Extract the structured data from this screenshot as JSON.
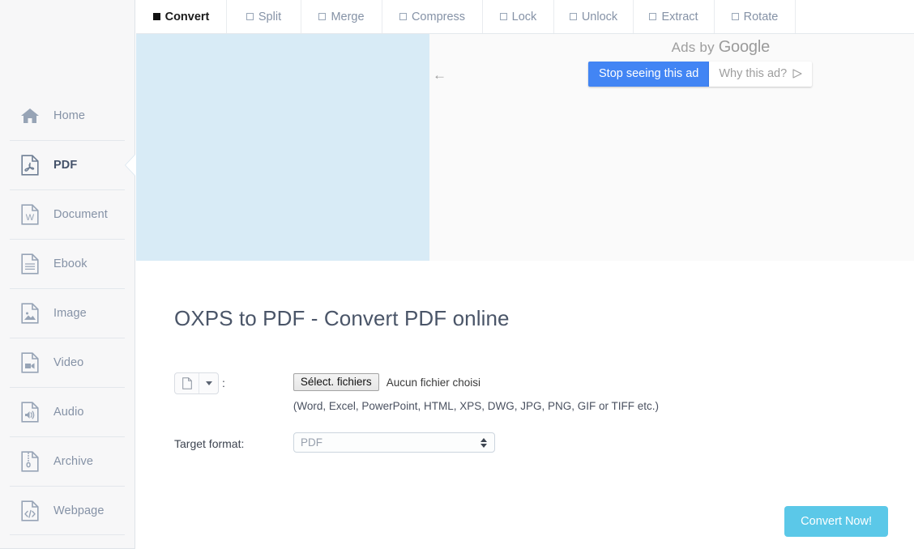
{
  "sidebar": {
    "items": [
      {
        "label": "Home",
        "icon": "home-icon",
        "active": false
      },
      {
        "label": "PDF",
        "icon": "pdf-file-icon",
        "active": true
      },
      {
        "label": "Document",
        "icon": "word-file-icon",
        "active": false
      },
      {
        "label": "Ebook",
        "icon": "ebook-file-icon",
        "active": false
      },
      {
        "label": "Image",
        "icon": "image-file-icon",
        "active": false
      },
      {
        "label": "Video",
        "icon": "video-file-icon",
        "active": false
      },
      {
        "label": "Audio",
        "icon": "audio-file-icon",
        "active": false
      },
      {
        "label": "Archive",
        "icon": "archive-file-icon",
        "active": false
      },
      {
        "label": "Webpage",
        "icon": "code-file-icon",
        "active": false
      }
    ]
  },
  "tabs": [
    {
      "label": "Convert",
      "active": true
    },
    {
      "label": "Split",
      "active": false
    },
    {
      "label": "Merge",
      "active": false
    },
    {
      "label": "Compress",
      "active": false
    },
    {
      "label": "Lock",
      "active": false
    },
    {
      "label": "Unlock",
      "active": false
    },
    {
      "label": "Extract",
      "active": false
    },
    {
      "label": "Rotate",
      "active": false
    }
  ],
  "ad": {
    "back_arrow": "←",
    "ads_by_prefix": "Ads by ",
    "ads_by_brand": "Google",
    "stop_seeing_label": "Stop seeing this ad",
    "why_this_ad_label": "Why this ad?",
    "blue_panel_color": "#d8ebf6",
    "stop_button_color": "#4285f4"
  },
  "main": {
    "title": "OXPS to PDF - Convert PDF online",
    "file_row": {
      "colon": ":",
      "select_files_label": "Sélect. fichiers",
      "no_file_text": "Aucun fichier choisi",
      "hint": "(Word, Excel, PowerPoint, HTML, XPS, DWG, JPG, PNG, GIF or TIFF etc.)"
    },
    "format_row": {
      "label": "Target format:",
      "value": "PDF"
    },
    "convert_button": "Convert Now!",
    "convert_button_color": "#5bc8e8"
  }
}
